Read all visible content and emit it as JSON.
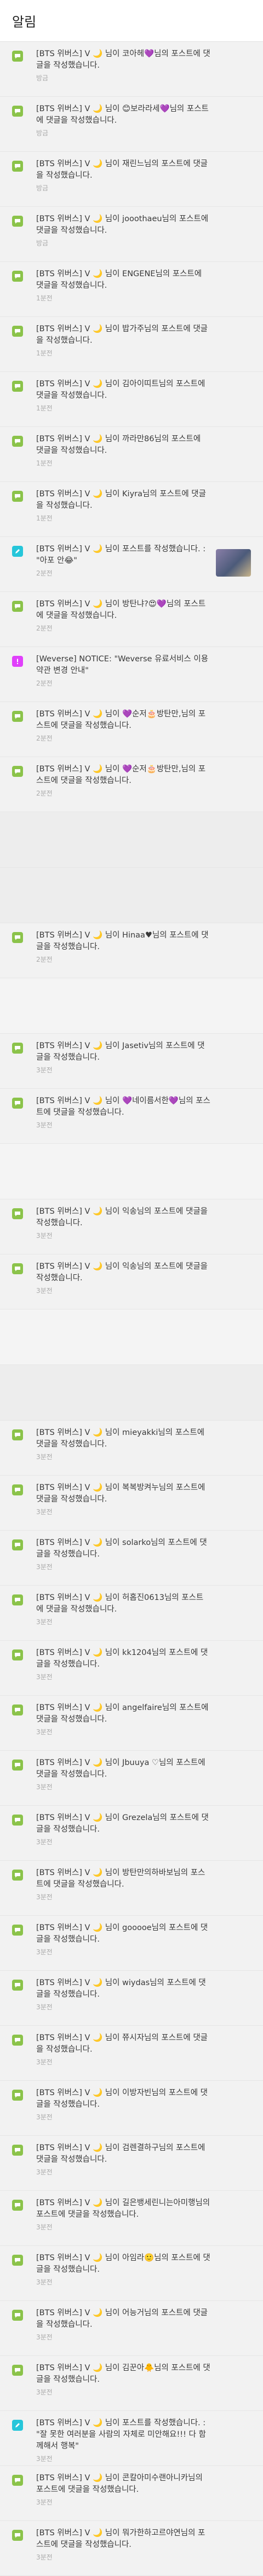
{
  "header": {
    "title": "알림"
  },
  "items": [
    {
      "kind": "comment",
      "text": "[BTS 위버스] V 🌙 님이 코아헤💜님의 포스트에 댓글을 작성했습니다.",
      "time": "방금",
      "h": 100
    },
    {
      "kind": "comment",
      "text": "[BTS 위버스] V 🌙 님이 😊보라라세💜님의 포스트에 댓글을 작성했습니다.",
      "time": "방금",
      "h": 100
    },
    {
      "kind": "comment",
      "text": "[BTS 위버스] V 🌙 님이 재린느님의 포스트에 댓글을 작성했습니다.",
      "time": "방금",
      "h": 100
    },
    {
      "kind": "comment",
      "text": "[BTS 위버스] V 🌙 님이 jooothaeu님의 포스트에 댓글을 작성했습니다.",
      "time": "방금",
      "h": 100
    },
    {
      "kind": "comment",
      "text": "[BTS 위버스] V 🌙 님이 ENGENE님의 포스트에 댓글을 작성했습니다.",
      "time": "1분전",
      "h": 100
    },
    {
      "kind": "comment",
      "text": "[BTS 위버스] V 🌙 님이 밥가주님의 포스트에 댓글을 작성했습니다.",
      "time": "1분전",
      "h": 100
    },
    {
      "kind": "comment",
      "text": "[BTS 위버스] V 🌙 님이 김아이띠트님의 포스트에 댓글을 작성했습니다.",
      "time": "1분전",
      "h": 100
    },
    {
      "kind": "comment",
      "text": "[BTS 위버스] V 🌙 님이 까라만86님의 포스트에 댓글을 작성했습니다.",
      "time": "1분전",
      "h": 100
    },
    {
      "kind": "comment",
      "text": "[BTS 위버스] V 🌙 님이 Kiyra님의 포스트에 댓글을 작성했습니다.",
      "time": "1분전",
      "h": 100
    },
    {
      "kind": "post",
      "text": "[BTS 위버스] V 🌙 님이 포스트를 작성했습니다. : \"아포 안😂\"",
      "time": "2분전",
      "h": 100,
      "thumb": true
    },
    {
      "kind": "comment",
      "text": "[BTS 위버스] V 🌙 님이 방탄냐?😍💜님의 포스트에 댓글을 작성했습니다.",
      "time": "2분전",
      "h": 100
    },
    {
      "kind": "notice",
      "text": "[Weverse] NOTICE: \"Weverse 유료서비스 이용약관 변경 안내\"",
      "time": "2분전",
      "h": 100
    },
    {
      "kind": "comment",
      "text": "[BTS 위버스] V 🌙 님이 💜순저🎂방탄만,님의 포스트에 댓글을 작성했습니다.",
      "time": "2분전",
      "h": 100
    },
    {
      "kind": "comment",
      "text": "[BTS 위버스] V 🌙 님이 💜순저🎂방탄만,님의 포스트에 댓글을 작성했습니다.",
      "time": "2분전",
      "h": 100
    },
    {
      "kind": "blank",
      "h": 100
    },
    {
      "kind": "blank",
      "h": 100
    },
    {
      "kind": "comment",
      "text": "[BTS 위버스] V 🌙 님이 Hinaa♥님의 포스트에 댓글을 작성했습니다.",
      "time": "2분전",
      "h": 100
    },
    {
      "kind": "blank",
      "s": true,
      "h": 100
    },
    {
      "kind": "comment",
      "text": "[BTS 위버스] V 🌙 님이 Jasetiv님의 포스트에 댓글을 작성했습니다.",
      "time": "3분전",
      "h": 100
    },
    {
      "kind": "comment",
      "text": "[BTS 위버스] V 🌙 님이 💜네이름서한💜님의 포스트에 댓글을 작성했습니다.",
      "time": "3분전",
      "h": 100
    },
    {
      "kind": "blank",
      "s": true,
      "h": 100
    },
    {
      "kind": "comment",
      "text": "[BTS 위버스] V 🌙 님이 익송님의 포스트에 댓글을 작성했습니다.",
      "time": "3분전",
      "h": 100
    },
    {
      "kind": "comment",
      "text": "[BTS 위버스] V 🌙 님이 익송님의 포스트에 댓글을 작성했습니다.",
      "time": "3분전",
      "h": 100
    },
    {
      "kind": "blank",
      "s": true,
      "h": 100
    },
    {
      "kind": "blank",
      "h": 100
    },
    {
      "kind": "comment",
      "text": "[BTS 위버스] V 🌙 님이 mieyakki님의 포스트에 댓글을 작성했습니다.",
      "time": "3분전",
      "h": 100
    },
    {
      "kind": "comment",
      "text": "[BTS 위버스] V 🌙 님이 복복방켜누님의 포스트에 댓글을 작성했습니다.",
      "time": "3분전",
      "h": 100
    },
    {
      "kind": "comment",
      "text": "[BTS 위버스] V 🌙 님이 solarko님의 포스트에 댓글을 작성했습니다.",
      "time": "3분전",
      "h": 100
    },
    {
      "kind": "comment",
      "text": "[BTS 위버스] V 🌙 님이 허홉진0613님의 포스트에 댓글을 작성했습니다.",
      "time": "3분전",
      "h": 100
    },
    {
      "kind": "comment",
      "text": "[BTS 위버스] V 🌙 님이 kk1204님의 포스트에 댓글을 작성했습니다.",
      "time": "3분전",
      "h": 100
    },
    {
      "kind": "comment",
      "text": "[BTS 위버스] V 🌙 님이 angelfaire님의 포스트에 댓글을 작성했습니다.",
      "time": "3분전",
      "h": 100
    },
    {
      "kind": "comment",
      "text": "[BTS 위버스] V 🌙 님이 Jbuuya ♡님의 포스트에 댓글을 작성했습니다.",
      "time": "3분전",
      "h": 100
    },
    {
      "kind": "comment",
      "text": "[BTS 위버스] V 🌙 님이 Grezela님의 포스트에 댓글을 작성했습니다.",
      "time": "3분전",
      "h": 100
    },
    {
      "kind": "comment",
      "text": "[BTS 위버스] V 🌙 님이 방탄만의하바보님의 포스트에 댓글을 작성했습니다.",
      "time": "3분전",
      "h": 100
    },
    {
      "kind": "comment",
      "text": "[BTS 위버스] V 🌙 님이 gooooe님의 포스트에 댓글을 작성했습니다.",
      "time": "3분전",
      "h": 100
    },
    {
      "kind": "comment",
      "text": "[BTS 위버스] V 🌙 님이 wiydas님의 포스트에 댓글을 작성했습니다.",
      "time": "3분전",
      "h": 100
    },
    {
      "kind": "comment",
      "text": "[BTS 위버스] V 🌙 님이 쮸시자님의 포스트에 댓글을 작성했습니다.",
      "time": "3분전",
      "h": 100
    },
    {
      "kind": "comment",
      "text": "[BTS 위버스] V 🌙 님이 이방자빈님의 포스트에 댓글을 작성했습니다.",
      "time": "3분전",
      "h": 100
    },
    {
      "kind": "comment",
      "text": "[BTS 위버스] V 🌙 님이 검렌결하구님의 포스트에 댓글을 작성했습니다.",
      "time": "3분전",
      "h": 100
    },
    {
      "kind": "comment",
      "text": "[BTS 위버스] V 🌙 님이 길은뱅세린니는아미행님의 포스트에 댓글을 작성했습니다.",
      "time": "3분전",
      "h": 100
    },
    {
      "kind": "comment",
      "text": "[BTS 위버스] V 🌙 님이 아임라🙂님의 포스트에 댓글을 작성했습니다.",
      "time": "3분전",
      "h": 100
    },
    {
      "kind": "comment",
      "text": "[BTS 위버스] V 🌙 님이 어능거님의 포스트에 댓글을 작성했습니다.",
      "time": "3분전",
      "h": 100
    },
    {
      "kind": "comment",
      "text": "[BTS 위버스] V 🌙 님이 김꾼아🐥님의 포스트에 댓글을 작성했습니다.",
      "time": "3분전",
      "h": 100
    },
    {
      "kind": "post",
      "text": "[BTS 위버스] V 🌙 님이 포스트를 작성했습니다. : \"잘 못한 여러분을 사람의 자체로 미안해요!!! 다 함께해서 행복\"",
      "time": "3분전",
      "h": 100
    },
    {
      "kind": "comment",
      "text": "[BTS 위버스] V 🌙 님이 콘칼아미수랜아니카님의 포스트에 댓글을 작성했습니다.",
      "time": "3분전",
      "h": 100
    },
    {
      "kind": "comment",
      "text": "[BTS 위버스] V 🌙 님이 뭐가한하고르야연님의 포스트에 댓글을 작성했습니다.",
      "time": "3분전",
      "h": 100
    }
  ]
}
